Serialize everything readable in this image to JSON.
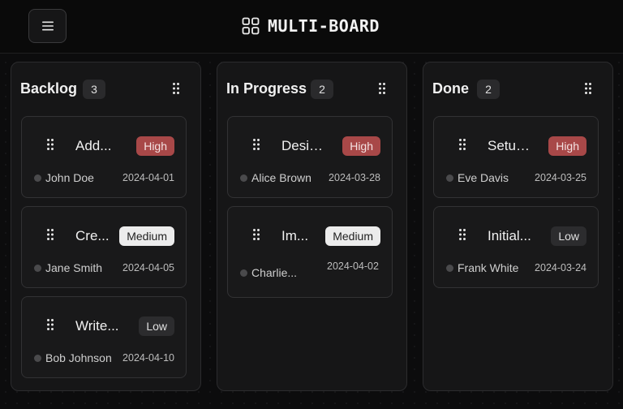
{
  "header": {
    "title": "MULTI-BOARD",
    "menu_icon": "hamburger-icon",
    "logo_icon": "grid-icon"
  },
  "colors": {
    "high": "#a84848",
    "medium": "#ececec",
    "low": "#2c2c2e"
  },
  "columns": [
    {
      "title": "Backlog",
      "count": "3",
      "cards": [
        {
          "title": "Add...",
          "priority": "High",
          "assignee": "John Doe",
          "date": "2024-04-01"
        },
        {
          "title": "Cre...",
          "priority": "Medium",
          "assignee": "Jane Smith",
          "date": "2024-04-05"
        },
        {
          "title": "Write...",
          "priority": "Low",
          "assignee": "Bob Johnson",
          "date": "2024-04-10"
        }
      ]
    },
    {
      "title": "In Progress",
      "count": "2",
      "cards": [
        {
          "title": "Desig...",
          "priority": "High",
          "assignee": "Alice Brown",
          "date": "2024-03-28"
        },
        {
          "title": "Im...",
          "priority": "Medium",
          "assignee": "Charlie...",
          "date": "2024-04-02"
        }
      ]
    },
    {
      "title": "Done",
      "count": "2",
      "cards": [
        {
          "title": "Setup...",
          "priority": "High",
          "assignee": "Eve Davis",
          "date": "2024-03-25"
        },
        {
          "title": "Initial...",
          "priority": "Low",
          "assignee": "Frank White",
          "date": "2024-03-24"
        }
      ]
    }
  ]
}
